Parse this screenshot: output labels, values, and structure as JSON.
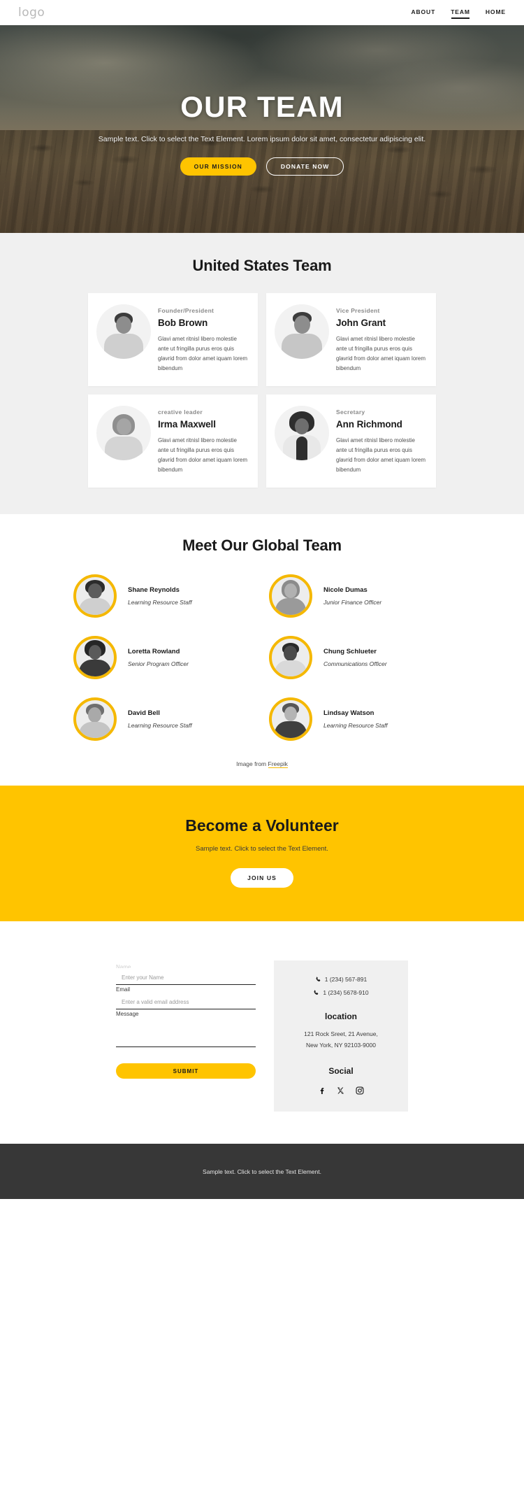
{
  "header": {
    "logo": "logo",
    "nav": [
      {
        "label": "ABOUT",
        "active": false
      },
      {
        "label": "TEAM",
        "active": true
      },
      {
        "label": "HOME",
        "active": false
      }
    ]
  },
  "hero": {
    "title": "OUR TEAM",
    "subtitle": "Sample text. Click to select the Text Element. Lorem ipsum dolor sit amet, consectetur adipiscing elit.",
    "primary_button": "OUR MISSION",
    "secondary_button": "DONATE NOW"
  },
  "us_team": {
    "title": "United States Team",
    "members": [
      {
        "role": "Founder/President",
        "name": "Bob Brown",
        "desc": "Glavi amet ritnisl libero molestie ante ut fringilla purus eros quis glavrid from dolor amet iquam lorem bibendum"
      },
      {
        "role": "Vice President",
        "name": "John Grant",
        "desc": "Glavi amet ritnisl libero molestie ante ut fringilla purus eros quis glavrid from dolor amet iquam lorem bibendum"
      },
      {
        "role": "creative leader",
        "name": "Irma Maxwell",
        "desc": "Glavi amet ritnisl libero molestie ante ut fringilla purus eros quis glavrid from dolor amet iquam lorem bibendum"
      },
      {
        "role": "Secretary",
        "name": "Ann Richmond",
        "desc": "Glavi amet ritnisl libero molestie ante ut fringilla purus eros quis glavrid from dolor amet iquam lorem bibendum"
      }
    ]
  },
  "global_team": {
    "title": "Meet Our Global Team",
    "members": [
      {
        "name": "Shane Reynolds",
        "role": "Learning Resource Staff"
      },
      {
        "name": "Nicole Dumas",
        "role": "Junior Finance Officer"
      },
      {
        "name": "Loretta Rowland",
        "role": "Senior Program Officer"
      },
      {
        "name": "Chung Schlueter",
        "role": "Communications Officer"
      },
      {
        "name": "David Bell",
        "role": "Learning Resource Staff"
      },
      {
        "name": "Lindsay Watson",
        "role": "Learning Resource Staff"
      }
    ],
    "credit_prefix": "Image from ",
    "credit_link": "Freepik"
  },
  "volunteer": {
    "title": "Become a Volunteer",
    "subtitle": "Sample text. Click to select the Text Element.",
    "button": "JOIN US"
  },
  "contact": {
    "form": {
      "name_label": "Name",
      "name_placeholder": "Enter your Name",
      "email_label": "Email",
      "email_placeholder": "Enter a valid email address",
      "message_label": "Message",
      "message_placeholder": "",
      "submit_label": "SUBMIT"
    },
    "info": {
      "phone_icon": "phone-icon",
      "phone1": "1 (234) 567-891",
      "phone2": "1 (234) 5678-910",
      "location_heading": "location",
      "address_line1": "121 Rock Sreet, 21 Avenue,",
      "address_line2": "New York, NY 92103-9000",
      "social_heading": "Social",
      "socials": [
        "facebook-icon",
        "x-twitter-icon",
        "instagram-icon"
      ]
    }
  },
  "footer": {
    "text": "Sample text. Click to select the Text Element."
  },
  "colors": {
    "accent_yellow": "#ffc400",
    "ring_yellow": "#f5b800",
    "section_gray": "#f0f0f0",
    "footer_dark": "#373737"
  }
}
